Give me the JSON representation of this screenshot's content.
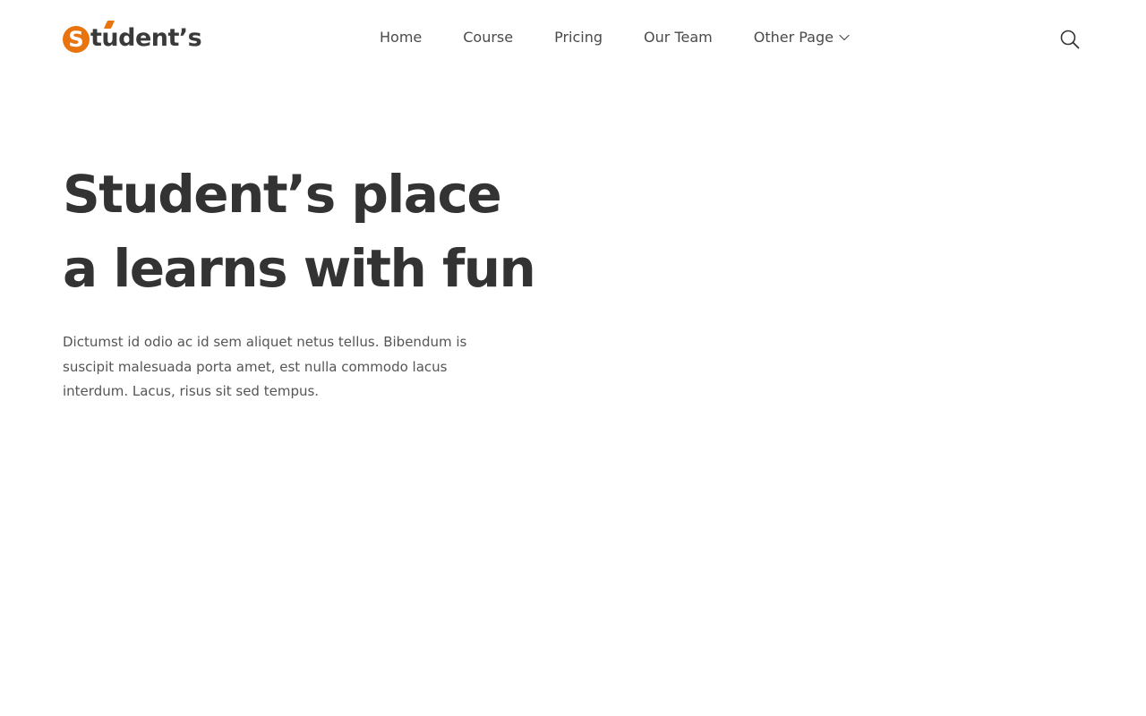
{
  "brand": {
    "logo_mark_letter": "S",
    "logo_text": "tudent’s",
    "accent_color": "#e8740e",
    "text_color": "#3a3a3a"
  },
  "nav": {
    "items": [
      {
        "label": "Home"
      },
      {
        "label": "Course"
      },
      {
        "label": "Pricing"
      },
      {
        "label": "Our Team"
      },
      {
        "label": "Other Page",
        "has_dropdown": true
      }
    ],
    "dropdown_icon": "chevron-down-icon",
    "search_icon": "search-icon"
  },
  "hero": {
    "title_line1": "Student’s place",
    "title_line2": "a learns with fun",
    "description": "Dictumst id odio ac id sem aliquet netus tellus. Bibendum is suscipit malesuada porta amet, est nulla commodo lacus interdum. Lacus, risus sit sed tempus."
  }
}
